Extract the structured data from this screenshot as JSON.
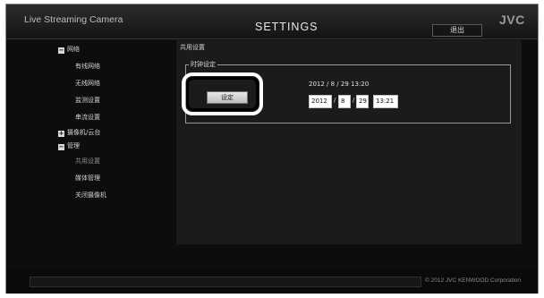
{
  "header": {
    "app_title": "Live Streaming Camera",
    "page_title": "SETTINGS",
    "logout_label": "退出",
    "logo_text": "JVC"
  },
  "sidebar": {
    "items": [
      {
        "label": "网络",
        "type": "group",
        "expanded": true,
        "icon": "collapse-icon"
      },
      {
        "label": "有线网络",
        "type": "item"
      },
      {
        "label": "无线网络",
        "type": "item"
      },
      {
        "label": "监测设置",
        "type": "item"
      },
      {
        "label": "串流设置",
        "type": "item"
      },
      {
        "label": "摄像机/云台",
        "type": "group",
        "expanded": false,
        "icon": "expand-icon"
      },
      {
        "label": "管理",
        "type": "group",
        "expanded": true,
        "icon": "collapse-icon"
      },
      {
        "label": "共用设置",
        "type": "item",
        "active": true
      },
      {
        "label": "媒体管理",
        "type": "item"
      },
      {
        "label": "关闭摄像机",
        "type": "item"
      }
    ]
  },
  "main": {
    "section_title": "共用设置",
    "clock": {
      "legend": "时钟设定",
      "set_button": "设定",
      "current_datetime": "2012 / 8 / 29 13:20",
      "year": "2012",
      "month": "8",
      "day": "29",
      "time": "13:21",
      "separator": "/"
    }
  },
  "footer": {
    "copyright": "© 2012 JVC KENWOOD Corporation"
  },
  "colors": {
    "background": "#0d0d0d",
    "panel": "#1b1b1b",
    "text": "#d4d4d4",
    "highlight": "#ffffff"
  }
}
